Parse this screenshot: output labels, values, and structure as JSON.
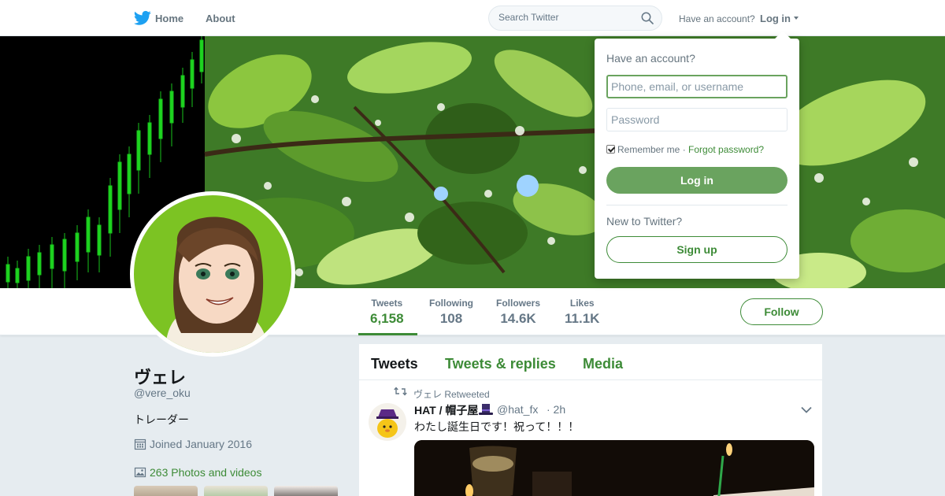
{
  "colors": {
    "accent": "#3d8b37",
    "accent_light": "#6aa35f",
    "brand": "#1da1f2",
    "bg": "#e6ecf0"
  },
  "nav": {
    "brand_icon": "twitter-bird-icon",
    "home": "Home",
    "about": "About",
    "search_placeholder": "Search Twitter",
    "have_account": "Have an account?",
    "login": "Log in"
  },
  "profile": {
    "name": "ヴェレ",
    "handle": "@vere_oku",
    "bio": "トレーダー",
    "joined": "Joined January 2016",
    "photos": "263 Photos and videos"
  },
  "stats": [
    {
      "label": "Tweets",
      "value": "6,158"
    },
    {
      "label": "Following",
      "value": "108"
    },
    {
      "label": "Followers",
      "value": "14.6K"
    },
    {
      "label": "Likes",
      "value": "11.1K"
    }
  ],
  "follow_label": "Follow",
  "tabs": [
    "Tweets",
    "Tweets & replies",
    "Media"
  ],
  "tweet": {
    "retweeted_by": "ヴェレ Retweeted",
    "author_name": "HAT / 帽子屋",
    "author_handle": "@hat_fx",
    "time": "· 2h",
    "text": "わたし誕生日です！祝って！！！"
  },
  "login_dropdown": {
    "title": "Have an account?",
    "username_placeholder": "Phone, email, or username",
    "password_placeholder": "Password",
    "remember": "Remember me",
    "separator": " · ",
    "forgot": "Forgot password?",
    "login_button": "Log in",
    "new_to": "New to Twitter?",
    "signup_button": "Sign up"
  }
}
